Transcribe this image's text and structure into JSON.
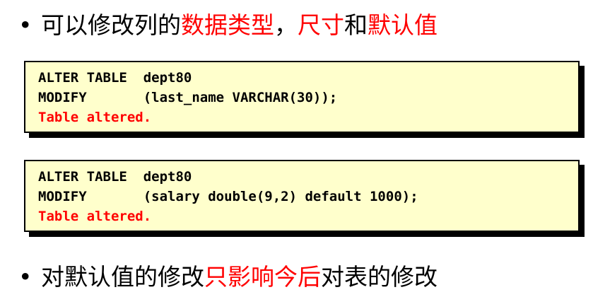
{
  "bullet1": {
    "dot": "•",
    "text_plain_a": "可以修改列的",
    "text_red_a": "数据类型",
    "text_plain_b": "，",
    "text_red_b": "尺寸",
    "text_plain_c": "和",
    "text_red_c": "默认值"
  },
  "code1": {
    "line1": "ALTER TABLE  dept80",
    "line2": "MODIFY       (last_name VARCHAR(30));",
    "result": "Table altered."
  },
  "code2": {
    "line1": "ALTER TABLE  dept80",
    "line2": "MODIFY       (salary double(9,2) default 1000);",
    "result": "Table altered."
  },
  "bullet2": {
    "dot": "•",
    "text_plain_a": "对默认值的修改",
    "text_red_a": "只影响今后",
    "text_plain_b": "对表的修改"
  },
  "colors": {
    "highlight": "#ff0000",
    "code_background": "#ffffcc",
    "shadow": "#000000"
  }
}
